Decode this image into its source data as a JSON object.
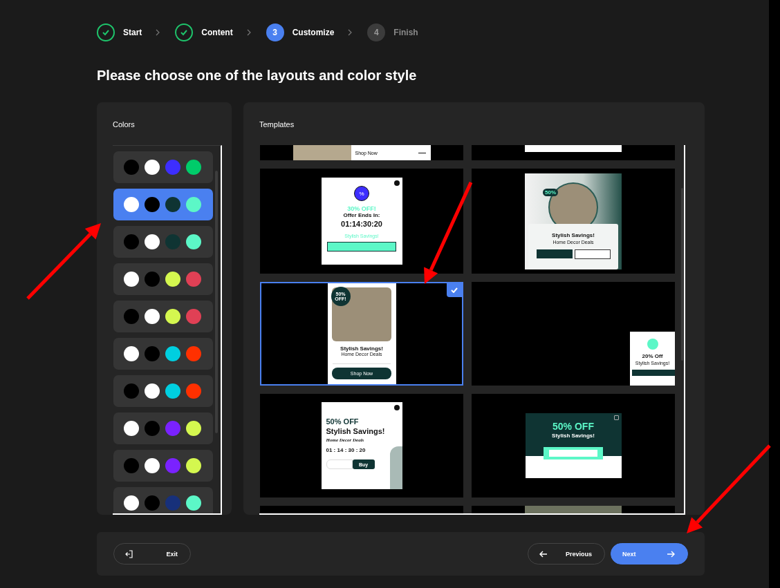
{
  "steps": [
    {
      "label": "Start",
      "done": true
    },
    {
      "label": "Content",
      "done": true
    },
    {
      "label": "Customize",
      "number": "3",
      "done": false,
      "current": true
    },
    {
      "label": "Finish",
      "number": "4",
      "done": false,
      "current": false
    }
  ],
  "title": "Please choose one of the layouts and color style",
  "colors_panel": {
    "heading": "Colors",
    "palettes": [
      {
        "selected": false,
        "swatches": [
          {
            "color": "#000000"
          },
          {
            "color": "#ffffff"
          },
          {
            "color": "#3d2eff"
          },
          {
            "color": "#00cc6a"
          }
        ]
      },
      {
        "selected": true,
        "swatches": [
          {
            "color": "#ffffff"
          },
          {
            "color": "#000000"
          },
          {
            "color": "#0f3433"
          },
          {
            "color": "#5cf7c7"
          }
        ]
      },
      {
        "selected": false,
        "swatches": [
          {
            "color": "#000000"
          },
          {
            "color": "#ffffff"
          },
          {
            "color": "#0f3433"
          },
          {
            "color": "#5cf7c7"
          }
        ]
      },
      {
        "selected": false,
        "swatches": [
          {
            "color": "#ffffff"
          },
          {
            "color": "#000000"
          },
          {
            "color": "#d4f74f"
          },
          {
            "color": "#e04055"
          }
        ]
      },
      {
        "selected": false,
        "swatches": [
          {
            "color": "#000000"
          },
          {
            "color": "#ffffff"
          },
          {
            "color": "#d4f74f"
          },
          {
            "color": "#e04055"
          }
        ]
      },
      {
        "selected": false,
        "swatches": [
          {
            "color": "#ffffff"
          },
          {
            "color": "#000000"
          },
          {
            "color": "#00cfe0"
          },
          {
            "color": "#ff3000"
          }
        ]
      },
      {
        "selected": false,
        "swatches": [
          {
            "color": "#000000"
          },
          {
            "color": "#ffffff"
          },
          {
            "color": "#00cfe0"
          },
          {
            "color": "#ff3000"
          }
        ]
      },
      {
        "selected": false,
        "swatches": [
          {
            "color": "#ffffff"
          },
          {
            "color": "#000000"
          },
          {
            "color": "#7a22ff"
          },
          {
            "color": "#d4f74f"
          }
        ]
      },
      {
        "selected": false,
        "swatches": [
          {
            "color": "#000000"
          },
          {
            "color": "#ffffff"
          },
          {
            "color": "#7a22ff"
          },
          {
            "color": "#d4f74f"
          }
        ]
      },
      {
        "selected": false,
        "swatches": [
          {
            "color": "#ffffff"
          },
          {
            "color": "#000000"
          },
          {
            "color": "#17307a"
          },
          {
            "color": "#5cf7c7"
          }
        ]
      }
    ]
  },
  "templates_panel": {
    "heading": "Templates",
    "templates": [
      {
        "kind": "banner-strip",
        "selected": false,
        "button": "Shop Now"
      },
      {
        "kind": "bar-strip",
        "selected": false
      },
      {
        "kind": "countdown",
        "selected": false,
        "badge": "%",
        "headline": "30% OFF!",
        "subtitle": "Offer Ends In:",
        "timer": "01:14:30:20",
        "tagline": "Stylish Savings!"
      },
      {
        "kind": "round-photo",
        "selected": false,
        "badge": "50%",
        "headline": "Stylish Savings!",
        "subtitle": "Home Decor Deals"
      },
      {
        "kind": "photo-card",
        "selected": true,
        "badge": "50% OFF!",
        "headline": "Stylish Savings!",
        "subtitle": "Home Decor Deals",
        "button": "Shop Now"
      },
      {
        "kind": "corner-card",
        "selected": false,
        "headline": "20% Off",
        "subtitle": "Stylish Savings!"
      },
      {
        "kind": "split-countdown",
        "selected": false,
        "headline": "50% OFF",
        "title": "Stylish Savings!",
        "subtitle": "Home Decor Deals",
        "timer": "01 : 14 : 30 : 20",
        "button": "Buy"
      },
      {
        "kind": "ticket",
        "selected": false,
        "headline": "50% OFF",
        "subtitle": "Stylish Savings!"
      },
      {
        "kind": "cut-top",
        "selected": false
      },
      {
        "kind": "cut-photo",
        "selected": false
      }
    ]
  },
  "footer": {
    "exit": "Exit",
    "previous": "Previous",
    "next": "Next"
  }
}
